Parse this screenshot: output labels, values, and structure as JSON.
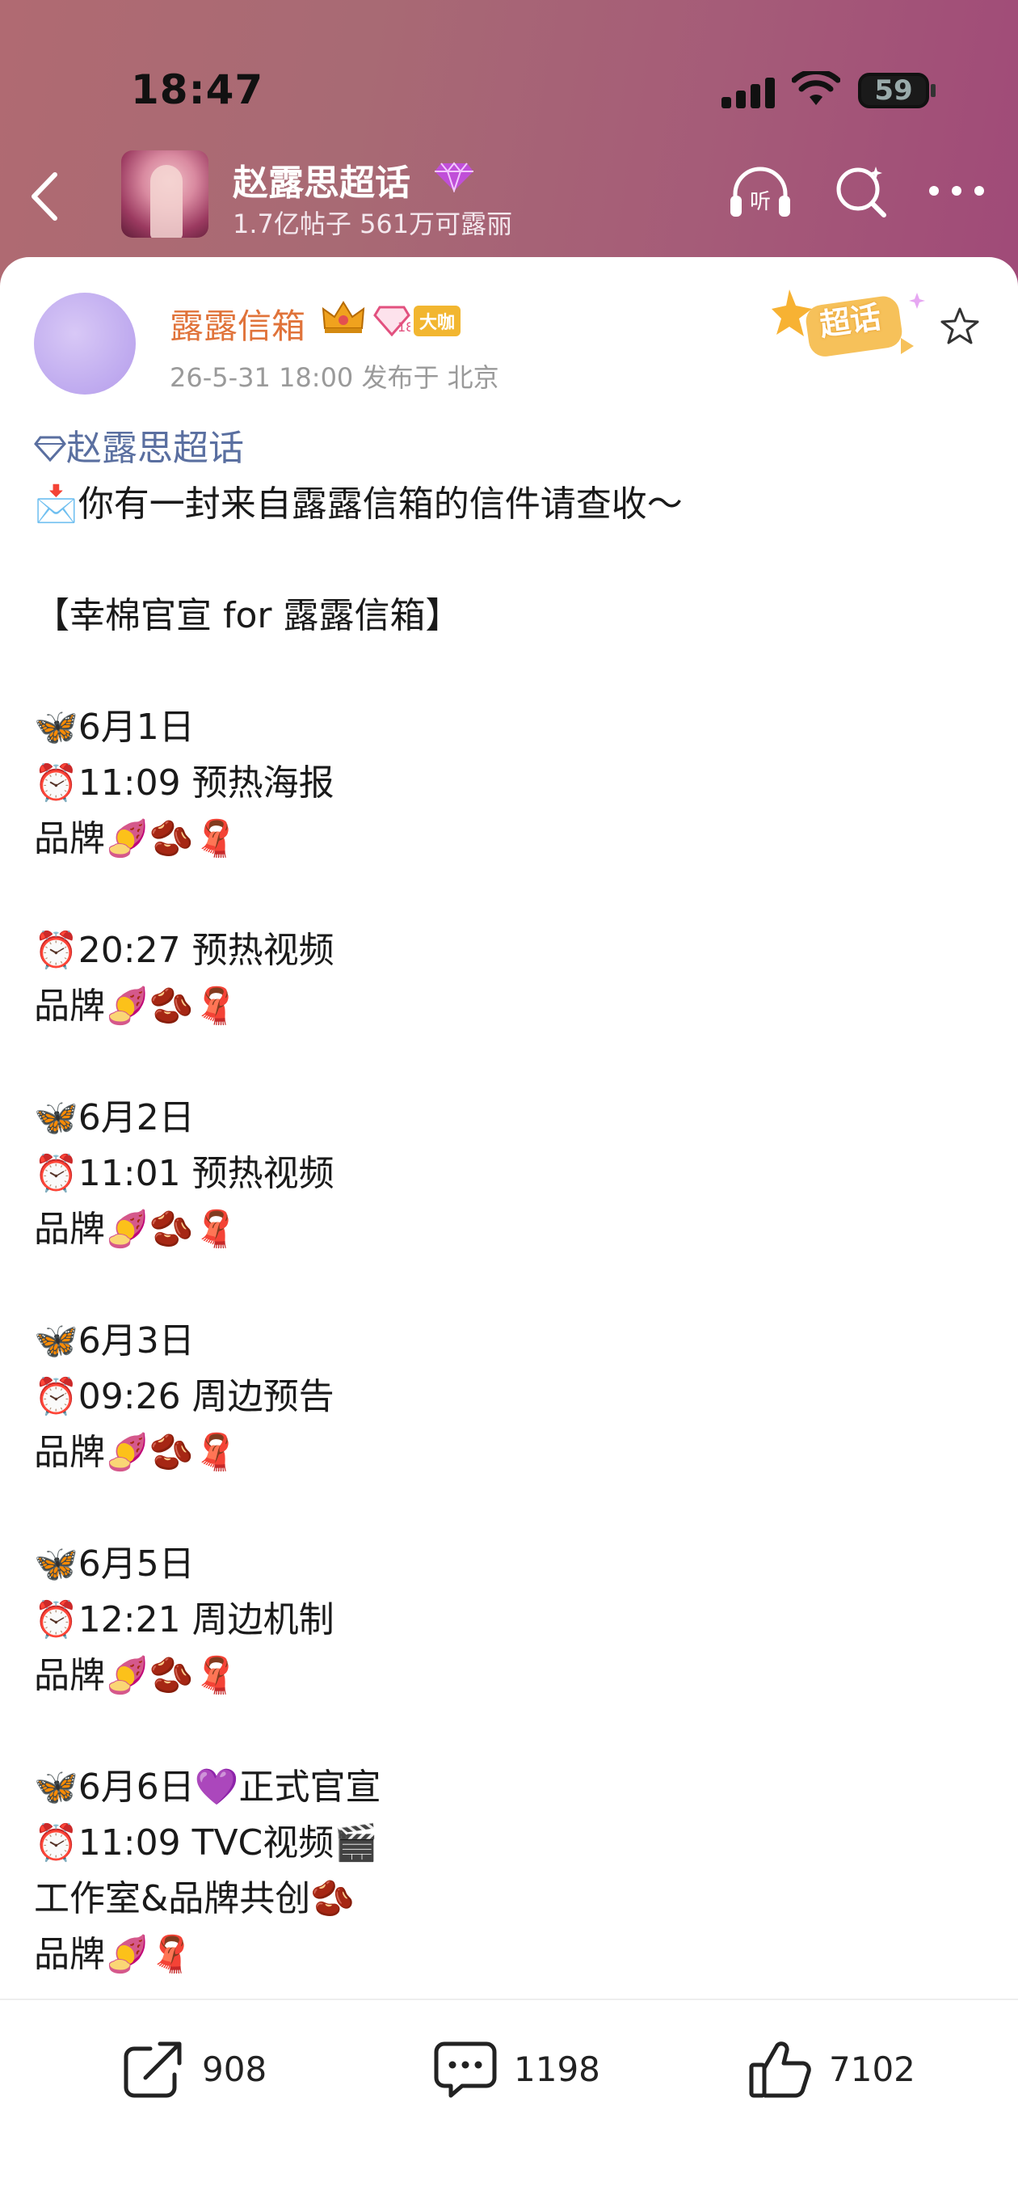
{
  "status": {
    "time": "18:47",
    "battery": "59"
  },
  "topic": {
    "title": "赵露思超话",
    "subtitle": "1.7亿帖子 561万可露丽"
  },
  "post": {
    "author": "露露信箱",
    "badge_label": "大咖",
    "level_badge": "18",
    "meta": "26-5-31 18:00  发布于 北京",
    "sticker_text": "超话",
    "lines": [
      "赵露思超话",
      "📩你有一封来自露露信箱的信件请查收～",
      "",
      "【幸棉官宣 for 露露信箱】",
      "",
      "🦋6月1日",
      "⏰11:09 预热海报",
      "品牌🍠🫘🧣",
      "",
      "⏰20:27 预热视频",
      "品牌🍠🫘🧣",
      "",
      "🦋6月2日",
      "⏰11:01 预热视频",
      "品牌🍠🫘🧣",
      "",
      "🦋6月3日",
      "⏰09:26 周边预告",
      "品牌🍠🫘🧣",
      "",
      "🦋6月5日",
      "⏰12:21 周边机制",
      "品牌🍠🫘🧣",
      "",
      "🦋6月6日💜正式官宣",
      "⏰11:09 TVC视频🎬",
      "工作室&品牌共创🫘",
      "品牌🍠🧣"
    ]
  },
  "actions": {
    "share_count": "908",
    "comment_count": "1198",
    "like_count": "7102"
  },
  "colors": {
    "accent_orange": "#e0733a",
    "topic_blue": "#5a6fa0",
    "header_gradient": "#a86a74"
  }
}
